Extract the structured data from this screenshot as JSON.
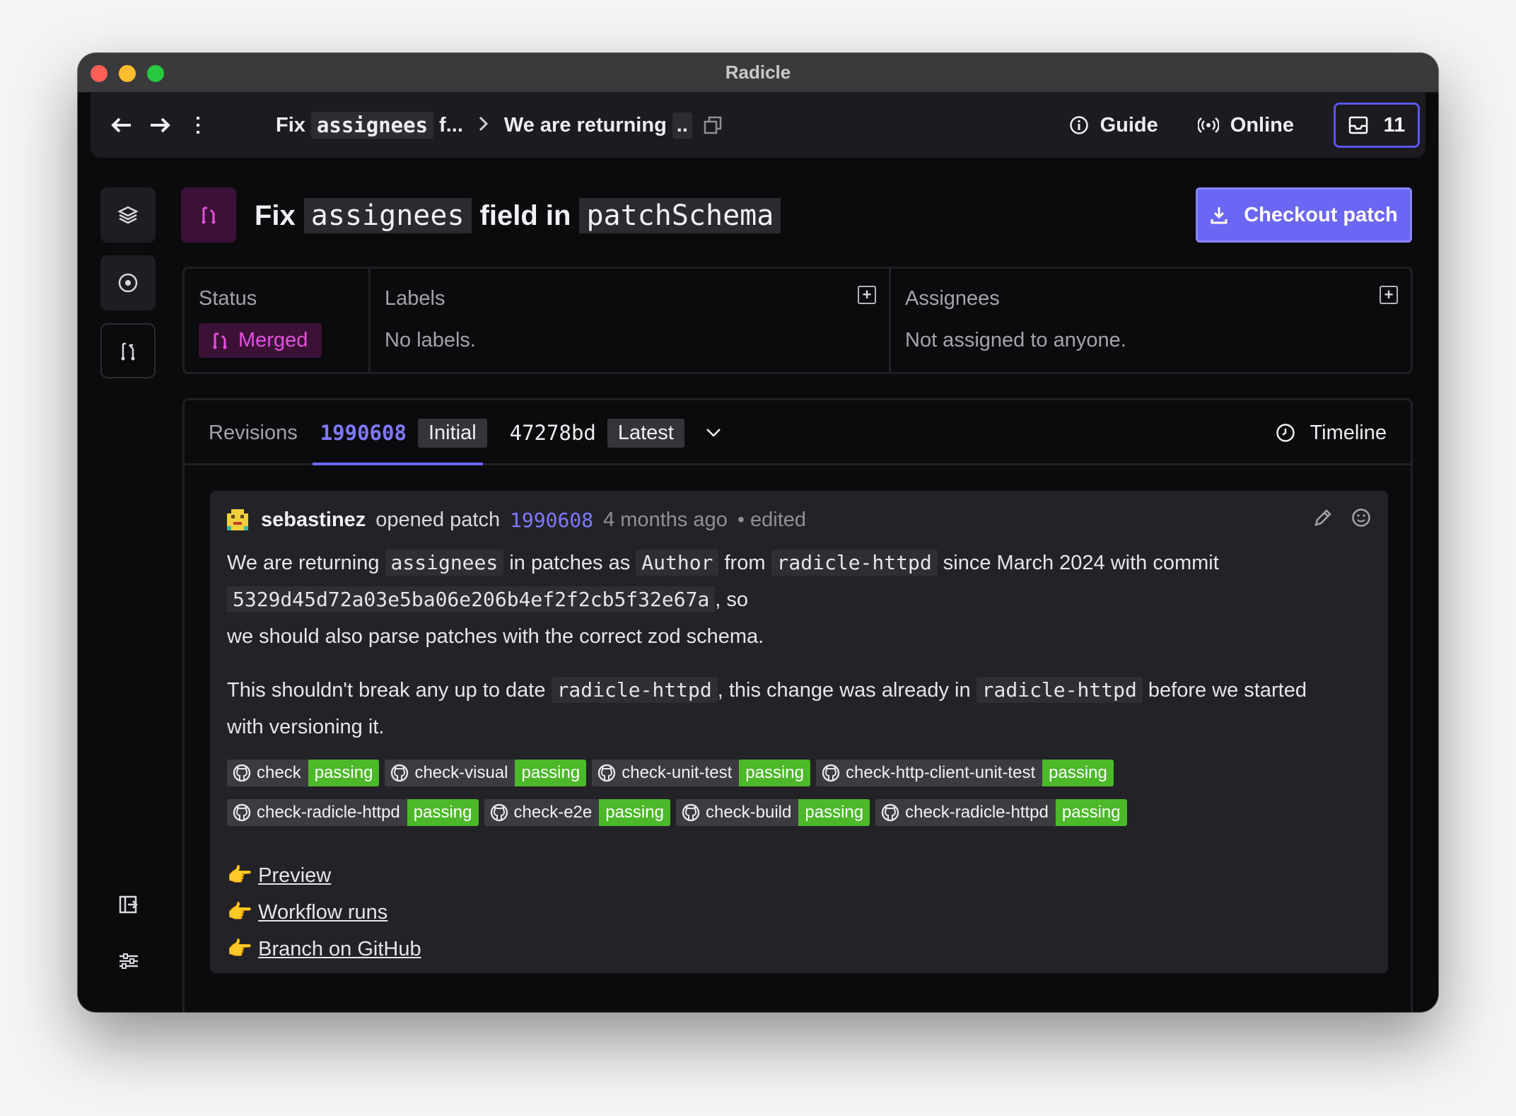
{
  "window": {
    "title": "Radicle"
  },
  "topbar": {
    "back_icon": "arrow-left-icon",
    "forward_icon": "arrow-right-icon",
    "more_icon": "more-vertical-icon",
    "breadcrumb": {
      "patch_prefix": "Fix",
      "patch_code": "assignees",
      "patch_suffix": "f...",
      "revision_text": "We are returning",
      "revision_suffix": ".."
    },
    "guide_label": "Guide",
    "online_label": "Online",
    "inbox_count": "11"
  },
  "sidebar": {
    "items": [
      {
        "name": "repos",
        "icon": "layers-icon"
      },
      {
        "name": "issues",
        "icon": "issue-icon"
      },
      {
        "name": "patches",
        "icon": "patch-icon"
      }
    ],
    "bottom": [
      {
        "name": "logout",
        "icon": "sign-out-icon"
      },
      {
        "name": "settings",
        "icon": "settings-sliders-icon"
      }
    ]
  },
  "patch": {
    "title_prefix": "Fix",
    "title_code1": "assignees",
    "title_middle": "field in",
    "title_code2": "patchSchema",
    "checkout_label": "Checkout patch"
  },
  "meta": {
    "status_label": "Status",
    "status_value": "Merged",
    "labels_label": "Labels",
    "labels_value": "No labels.",
    "assignees_label": "Assignees",
    "assignees_value": "Not assigned to anyone."
  },
  "revisions": {
    "label": "Revisions",
    "items": [
      {
        "id": "1990608",
        "badge": "Initial",
        "active": true
      },
      {
        "id": "47278bd",
        "badge": "Latest",
        "active": false
      }
    ],
    "timeline_label": "Timeline"
  },
  "comment": {
    "author": "sebastinez",
    "action": "opened patch",
    "revision": "1990608",
    "time": "4 months ago",
    "edited": "• edited",
    "p1_a": "We are returning",
    "p1_code1": "assignees",
    "p1_b": "in patches as",
    "p1_code2": "Author",
    "p1_c": "from",
    "p1_code3": "radicle-httpd",
    "p1_d": "since March 2024 with commit",
    "p1_commit": "5329d45d72a03e5ba06e206b4ef2f2cb5f32e67a",
    "p1_e": ", so",
    "p1_f": "we should also parse patches with the correct zod schema.",
    "p2_a": "This shouldn't break any up to date",
    "p2_code1": "radicle-httpd",
    "p2_b": ", this change was already in",
    "p2_code2": "radicle-httpd",
    "p2_c": "before we started",
    "p2_d": "with versioning it.",
    "checks_row1": [
      {
        "name": "check",
        "status": "passing"
      },
      {
        "name": "check-visual",
        "status": "passing"
      },
      {
        "name": "check-unit-test",
        "status": "passing"
      },
      {
        "name": "check-http-client-unit-test",
        "status": "passing"
      }
    ],
    "checks_row2": [
      {
        "name": "check-radicle-httpd",
        "status": "passing"
      },
      {
        "name": "check-e2e",
        "status": "passing"
      },
      {
        "name": "check-build",
        "status": "passing"
      },
      {
        "name": "check-radicle-httpd",
        "status": "passing"
      }
    ],
    "links": [
      {
        "emoji": "👉",
        "label": "Preview"
      },
      {
        "emoji": "👉",
        "label": "Workflow runs"
      },
      {
        "emoji": "👉",
        "label": "Branch on GitHub"
      }
    ]
  },
  "colors": {
    "accent": "#6c66f4",
    "merged": "#e64fe0",
    "passing": "#4cb82a"
  }
}
